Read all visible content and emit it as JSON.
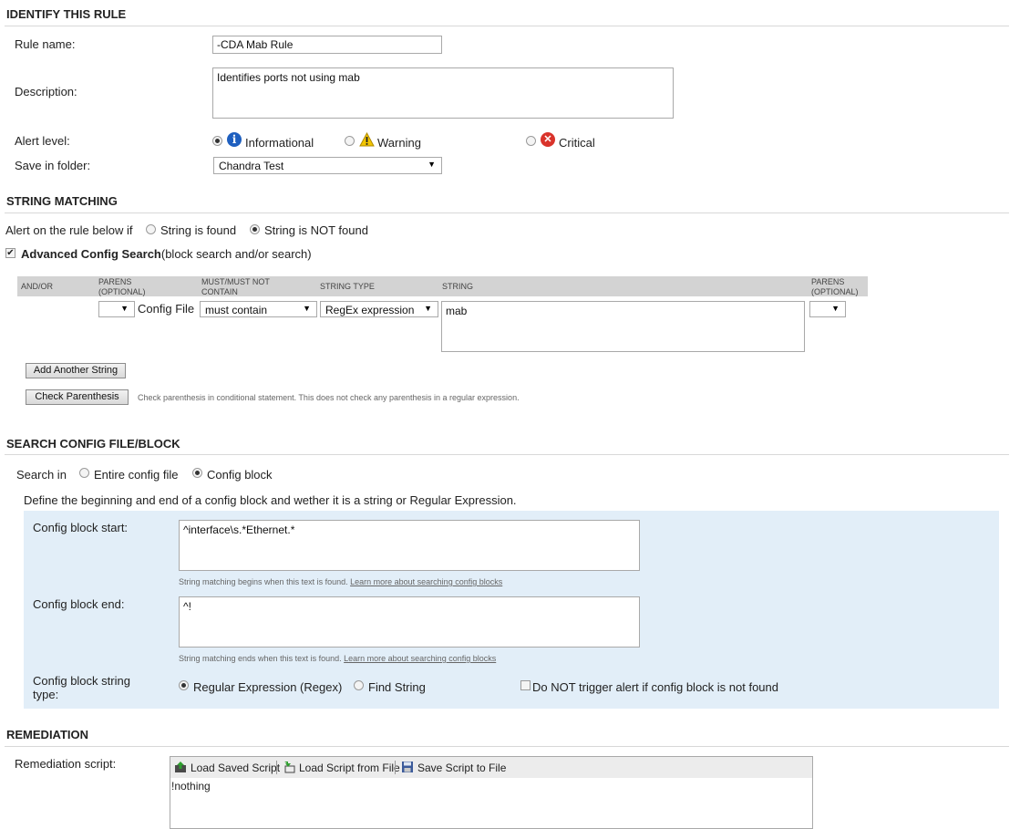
{
  "identify": {
    "header": "IDENTIFY THIS RULE",
    "rule_name_label": "Rule name:",
    "rule_name_value": "-CDA Mab Rule",
    "description_label": "Description:",
    "description_value": "Identifies ports not using mab",
    "alert_level_label": "Alert level:",
    "alert_levels": [
      {
        "label": "Informational",
        "icon": "info-icon",
        "selected": true
      },
      {
        "label": "Warning",
        "icon": "warning-icon",
        "selected": false
      },
      {
        "label": "Critical",
        "icon": "critical-icon",
        "selected": false
      }
    ],
    "folder_label": "Save in folder:",
    "folder_value": "Chandra Test"
  },
  "string_matching": {
    "header": "STRING MATCHING",
    "alert_prefix": "Alert on the rule below if",
    "option_found": "String is found",
    "option_not_found": "String is NOT found",
    "advanced_label": "Advanced Config Search",
    "advanced_sub": "(block search and/or search)",
    "columns": {
      "and_or": "AND/OR",
      "parens_open": "PARENS (OPTIONAL)",
      "must": "MUST/MUST NOT CONTAIN",
      "string_type": "STRING TYPE",
      "string": "STRING",
      "parens_close": "PARENS (OPTIONAL)"
    },
    "row": {
      "config_file_label": "Config File",
      "must_value": "must contain",
      "type_value": "RegEx expression",
      "string_value": "mab"
    },
    "add_button": "Add Another String",
    "check_button": "Check Parenthesis",
    "check_note": "Check parenthesis in conditional statement. This does not check any parenthesis in a regular expression."
  },
  "search_block": {
    "header": "SEARCH CONFIG FILE/BLOCK",
    "search_in_label": "Search in",
    "option_entire": "Entire config file",
    "option_block": "Config block",
    "define_text": "Define the beginning and end of a config block and wether it is a string or Regular Expression.",
    "start_label": "Config block start:",
    "start_value": "^interface\\s.*Ethernet.*",
    "start_hint": "String matching begins when this text is found.",
    "end_label": "Config block end:",
    "end_value": "^!",
    "end_hint": "String matching ends when this text is found.",
    "learn_more": "Learn more about searching config blocks",
    "type_label_1": "Config block string",
    "type_label_2": "type:",
    "option_regex": "Regular Expression (Regex)",
    "option_find": "Find String",
    "no_trigger_label": "Do NOT trigger alert if config block is not found"
  },
  "remediation": {
    "header": "REMEDIATION",
    "script_label": "Remediation script:",
    "toolbar": {
      "load_saved": "Load Saved Script",
      "load_file": "Load Script from File",
      "save_file": "Save Script to File"
    },
    "script_value": "!nothing"
  },
  "colors": {
    "panel_bg": "#e2eef8",
    "table_header_bg": "#d3d3d3",
    "info_blue": "#1e5fbf",
    "critical_red": "#d9332b",
    "warning_yellow": "#f2c500"
  }
}
